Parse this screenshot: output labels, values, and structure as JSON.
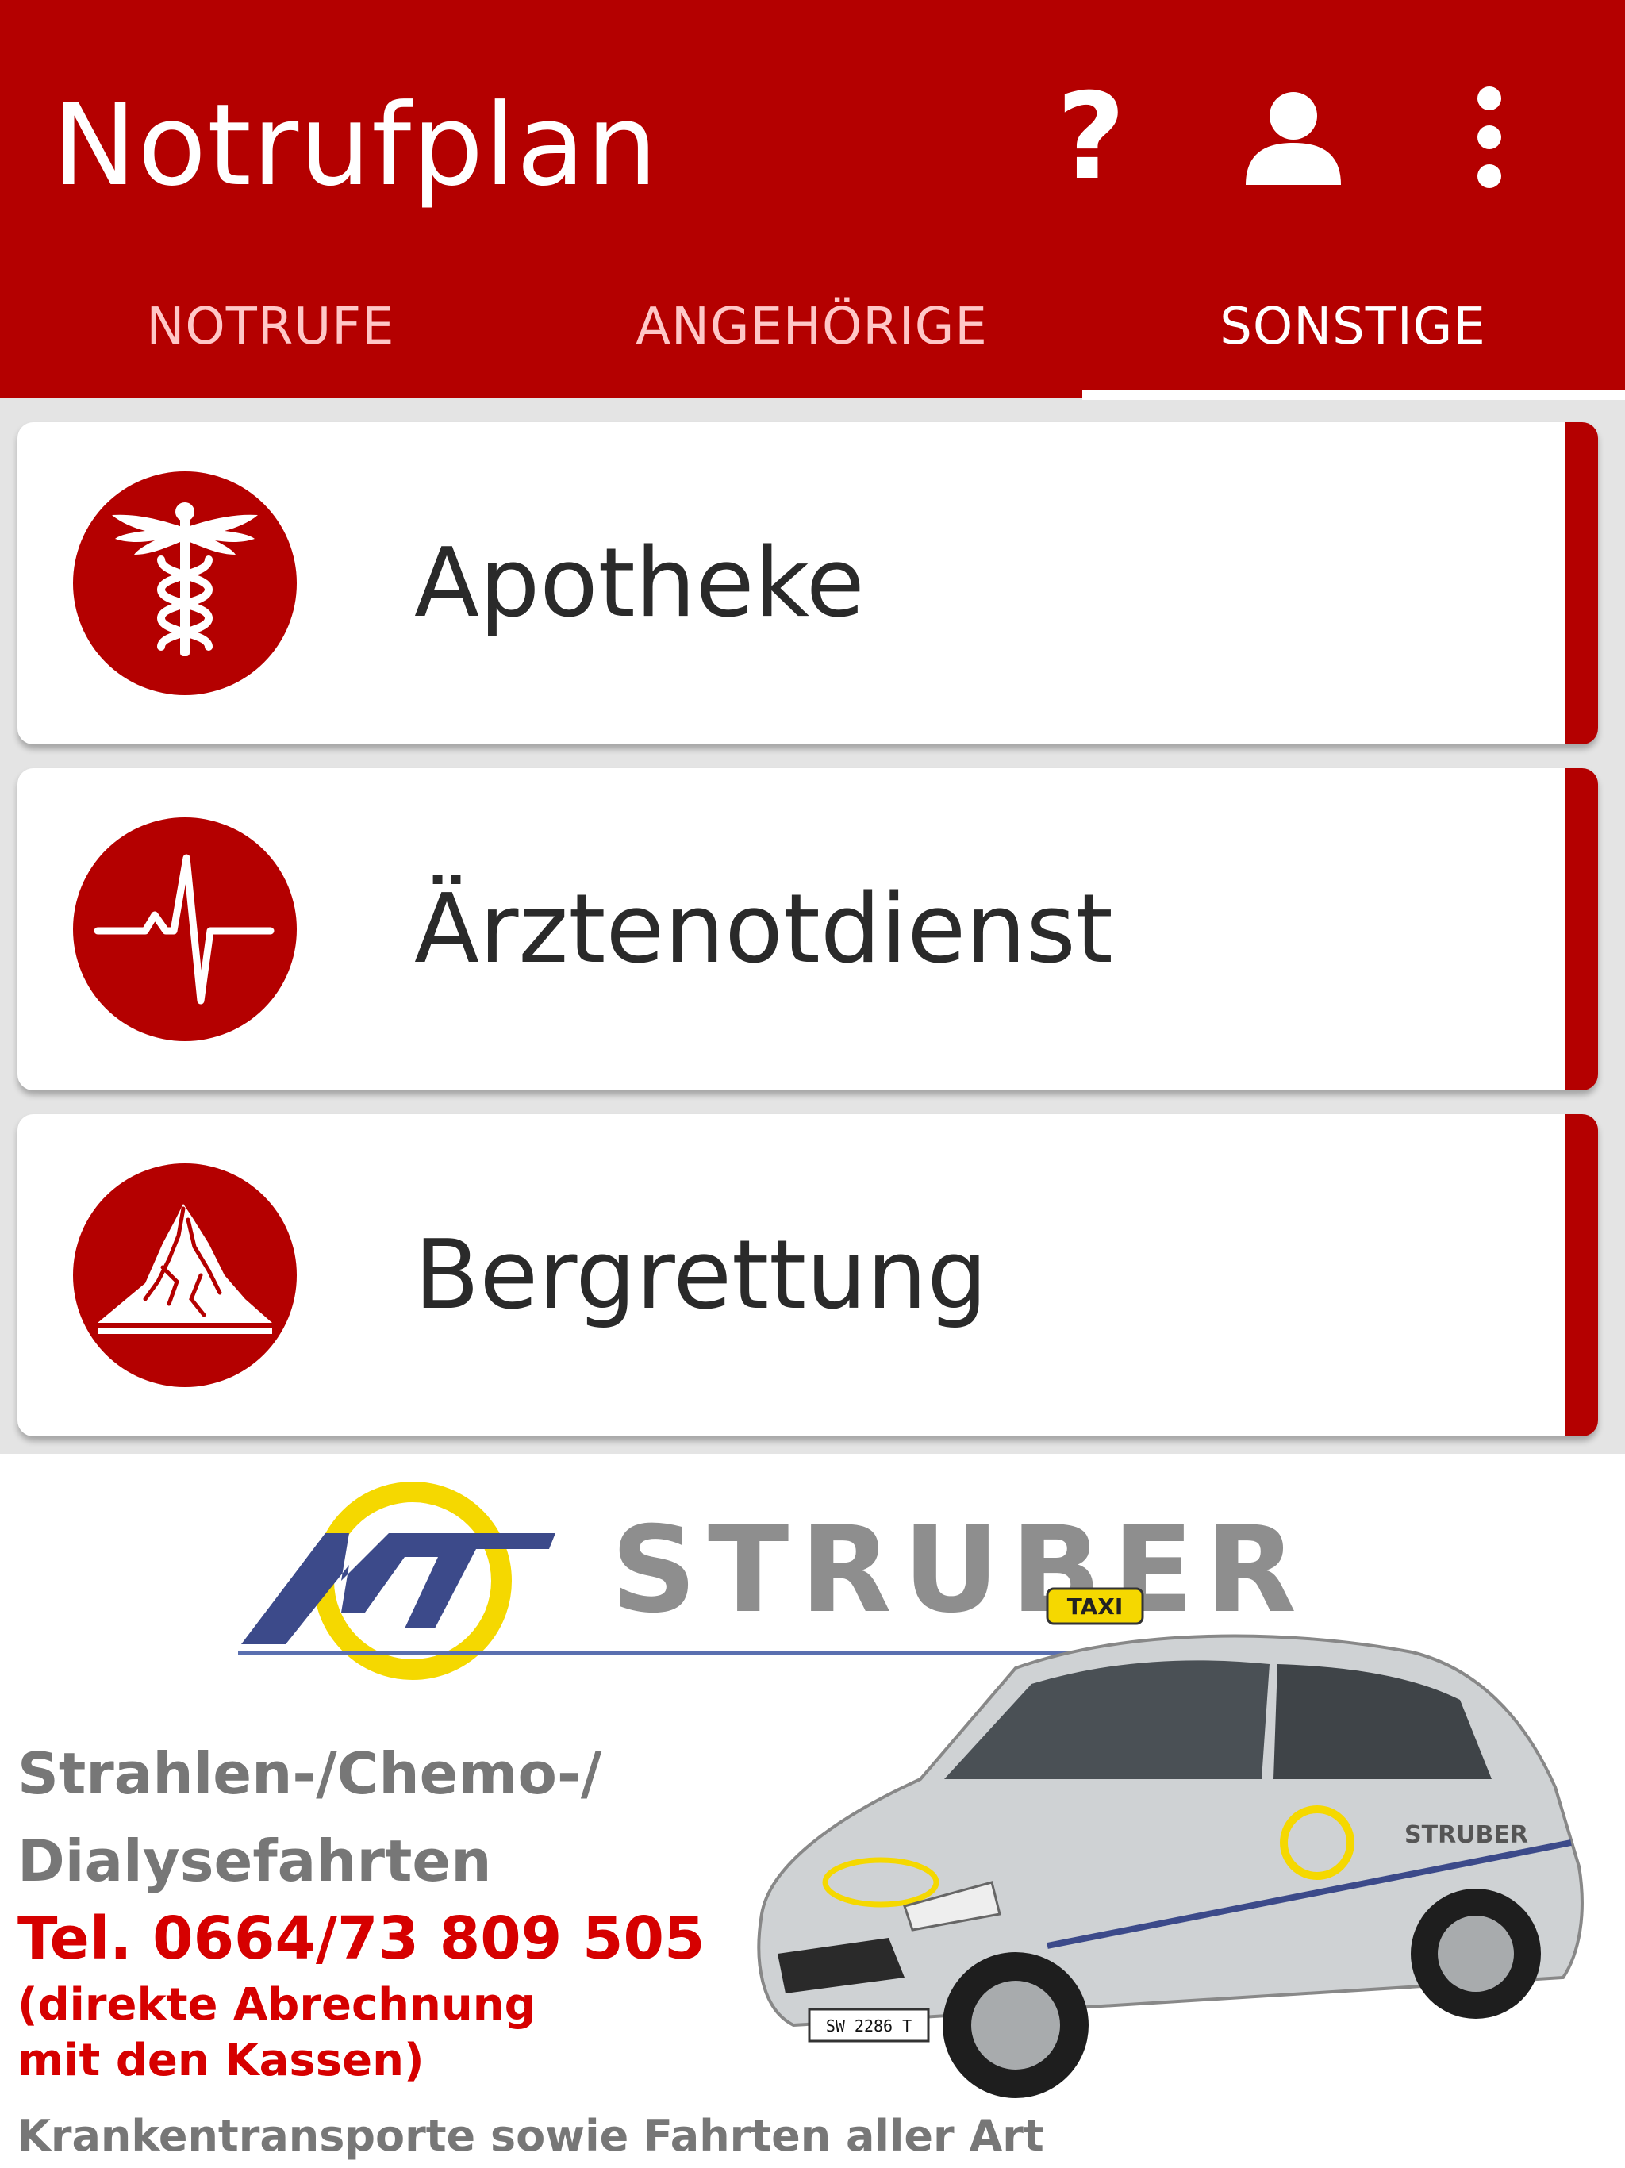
{
  "app": {
    "title": "Notrufplan",
    "actions": [
      {
        "name": "help",
        "icon": "help-icon",
        "glyph": "?"
      },
      {
        "name": "account",
        "icon": "person-icon"
      },
      {
        "name": "more",
        "icon": "more-vert-icon"
      }
    ]
  },
  "tabs": [
    {
      "label": "NOTRUFE",
      "active": false
    },
    {
      "label": "ANGEHÖRIGE",
      "active": false
    },
    {
      "label": "SONSTIGE",
      "active": true
    }
  ],
  "cards": [
    {
      "label": "Apotheke",
      "icon": "caduceus-icon"
    },
    {
      "label": "Ärztenotdienst",
      "icon": "heartbeat-icon"
    },
    {
      "label": "Bergrettung",
      "icon": "mountain-icon"
    }
  ],
  "ad": {
    "brand": "STRUBER",
    "logo_letters": "MT",
    "line1": "Strahlen-/Chemo-/",
    "line2": "Dialysefahrten",
    "phone": "Tel. 0664/73 809 505",
    "note1": "(direkte Abrechnung",
    "note2": "mit den Kassen)",
    "footer": "Krankentransporte sowie Fahrten aller Art",
    "taxi_sign": "TAXI",
    "plate": "SW 2286 T"
  },
  "colors": {
    "primary": "#b40000",
    "ad_red": "#d60000",
    "ad_gray": "#777777",
    "logo_yellow": "#f5d800",
    "logo_blue": "#3c4a8a"
  }
}
